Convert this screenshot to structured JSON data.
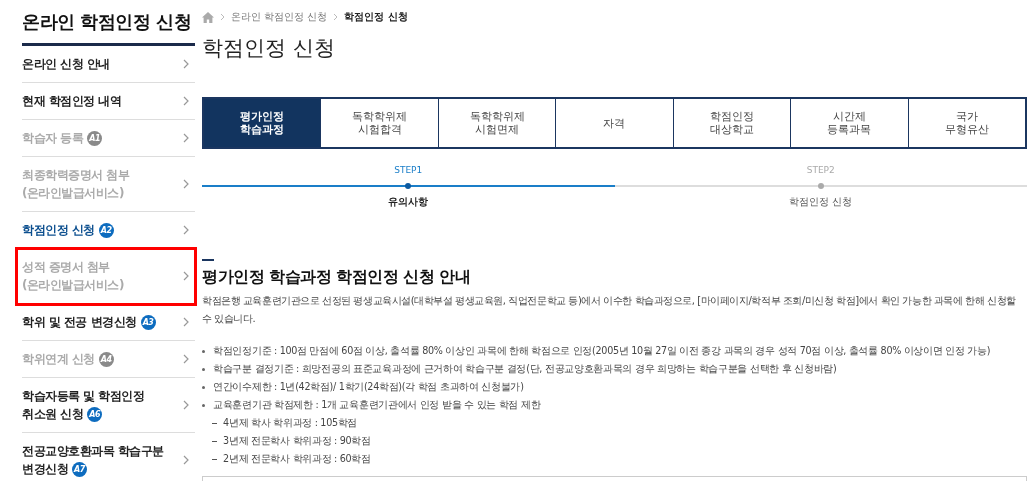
{
  "sidebar": {
    "title": "온라인 학점인정 신청",
    "items": [
      {
        "label": "온라인 신청 안내",
        "disabled": false,
        "current": false,
        "highlighted": false
      },
      {
        "label": "현재 학점인정 내역",
        "disabled": false,
        "current": false,
        "highlighted": false
      },
      {
        "label": "학습자 등록",
        "badge": "A1",
        "disabled": true,
        "current": false,
        "highlighted": false
      },
      {
        "label": "최종학력증명서 첨부\n(온라인발급서비스)",
        "disabled": true,
        "current": false,
        "highlighted": false
      },
      {
        "label": "학점인정 신청",
        "badge": "A2",
        "disabled": false,
        "current": true,
        "highlighted": false
      },
      {
        "label": "성적 증명서 첨부\n(온라인발급서비스)",
        "disabled": true,
        "current": false,
        "highlighted": true
      },
      {
        "label": "학위 및 전공 변경신청",
        "badge": "A3",
        "disabled": false,
        "current": false,
        "highlighted": false
      },
      {
        "label": "학위연계 신청",
        "badge": "A4",
        "disabled": true,
        "current": false,
        "highlighted": false
      },
      {
        "label": "학습자등록 및 학점인정\n취소원 신청",
        "badge": "A6",
        "disabled": false,
        "current": false,
        "highlighted": false
      },
      {
        "label": "전공교양호환과목 학습구분\n변경신청",
        "badge": "A7",
        "disabled": false,
        "current": false,
        "highlighted": false
      }
    ]
  },
  "breadcrumb": [
    "온라인 학점인정 신청",
    "학점인정 신청"
  ],
  "page_title": "학점인정 신청",
  "tabs": [
    {
      "label": "평가인정\n학습과정",
      "selected": true
    },
    {
      "label": "독학학위제\n시험합격",
      "selected": false
    },
    {
      "label": "독학학위제\n시험면제",
      "selected": false
    },
    {
      "label": "자격",
      "selected": false
    },
    {
      "label": "학점인정\n대상학교",
      "selected": false
    },
    {
      "label": "시간제\n등록과목",
      "selected": false
    },
    {
      "label": "국가\n무형유산",
      "selected": false
    }
  ],
  "steps": [
    {
      "step": "STEP1",
      "label": "유의사항",
      "active": true
    },
    {
      "step": "STEP2",
      "label": "학점인정 신청",
      "active": false
    }
  ],
  "section": {
    "heading": "평가인정 학습과정 학점인정 신청 안내",
    "intro": "학점은행 교육훈련기관으로 선정된 평생교육시설(대학부설 평생교육원, 직업전문학교 등)에서 이수한 학습과정으로, [마이페이지/학적부 조회/미신청 학점]에서 확인 가능한 과목에 한해 신청할 수 있습니다.",
    "bullets": [
      {
        "text": "학점인정기준 : 100점 만점에 60점 이상, 출석률 80% 이상인 과목에 한해 학점으로 인정(2005년 10월 27일 이전 종강 과목의 경우 성적 70점 이상, 출석률 80% 이상이면 인정 가능)"
      },
      {
        "text": "학습구분 결정기준 : 희망전공의 표준교육과정에 근거하여 학습구분 결정(단, 전공교양호환과목의 경우 희망하는 학습구분을 선택한 후 신청바람)"
      },
      {
        "text": "연간이수제한 : 1년(42학점)/ 1학기(24학점)(각 학점 초과하여 신청불가)"
      },
      {
        "text": "교육훈련기관 학점제한 : 1개 교육훈련기관에서 인정 받을 수 있는 학점 제한",
        "children": [
          {
            "text": "4년제 학사 학위과정 : 105학점"
          },
          {
            "text": "3년제 전문학사 학위과정 : 90학점"
          },
          {
            "text": "2년제 전문학사 학위과정 : 60학점"
          }
        ]
      }
    ]
  }
}
